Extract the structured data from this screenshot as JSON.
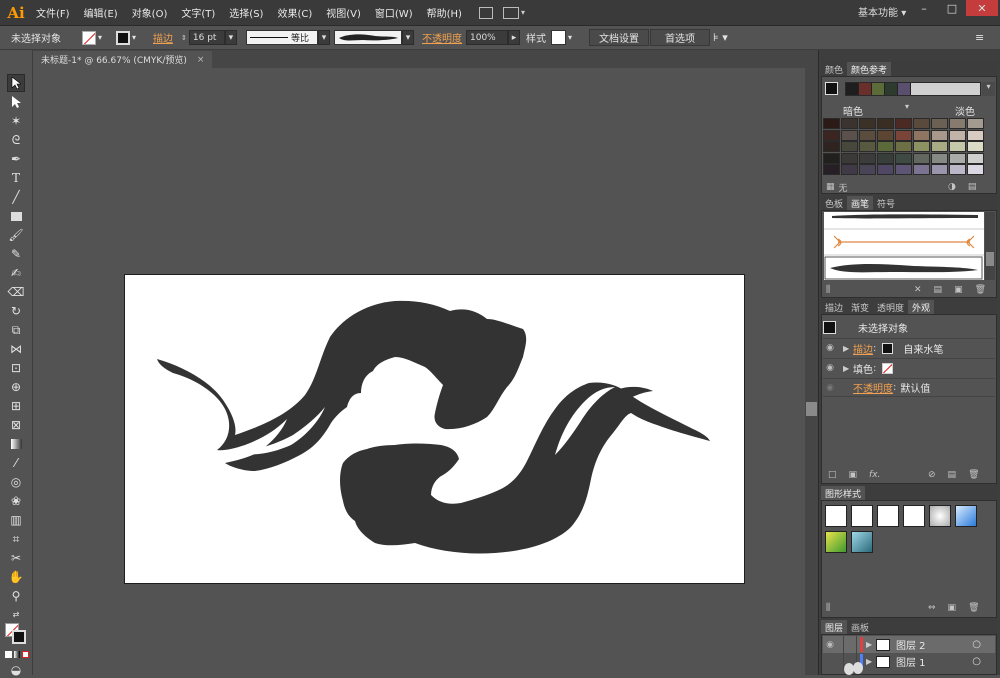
{
  "app": {
    "logo": "Ai",
    "menus": [
      "文件(F)",
      "编辑(E)",
      "对象(O)",
      "文字(T)",
      "选择(S)",
      "效果(C)",
      "视图(V)",
      "窗口(W)",
      "帮助(H)"
    ],
    "workspace": "基本功能",
    "window_controls": [
      "–",
      "□",
      "✕"
    ]
  },
  "control_bar": {
    "selection_label": "未选择对象",
    "stroke_label": "描边",
    "stroke_value": "16 pt",
    "stroke_profile": "等比",
    "opacity_label": "不透明度",
    "opacity_value": "100%",
    "style_label": "样式",
    "doc_setup_button": "文档设置",
    "preferences_button": "首选项"
  },
  "document_tab": {
    "title": "未标题-1* @ 66.67% (CMYK/预览)",
    "close": "×"
  },
  "color_panel": {
    "tabs": [
      "颜色",
      "颜色参考"
    ],
    "dark_label": "暗色",
    "light_label": "淡色",
    "none_label": "无",
    "harmony_colors": [
      "#1e1e1e",
      "#6b2f2b",
      "#5c6b3a",
      "#2c3b2e",
      "#5a4f6e"
    ],
    "grid_colors": [
      [
        "#2b1a16",
        "#3a3330",
        "#3b3127",
        "#3a2d22",
        "#4a2a22",
        "#5a4a3c",
        "#6b6054",
        "#877b70",
        "#a39b90"
      ],
      [
        "#3a2520",
        "#5a514c",
        "#5a4d3d",
        "#5d4533",
        "#7a4438",
        "#8f7462",
        "#a8978a",
        "#c2b3a8",
        "#d8ccc2"
      ],
      [
        "#2f2320",
        "#48473c",
        "#575a3e",
        "#5b6a38",
        "#6d6f45",
        "#8e9161",
        "#a9ab84",
        "#c6c7a8",
        "#dcdcc6"
      ],
      [
        "#22201e",
        "#3b3a38",
        "#3c3c3c",
        "#383f3a",
        "#3f4a44",
        "#62675f",
        "#868a84",
        "#aaaca9",
        "#cfcfcd"
      ],
      [
        "#262026",
        "#3f3a46",
        "#4a4457",
        "#4f4763",
        "#5e5574",
        "#7b7390",
        "#9b95ac",
        "#bcb7c8",
        "#dcd8e3"
      ]
    ]
  },
  "brushes_panel": {
    "tabs": [
      "色板",
      "画笔",
      "符号"
    ]
  },
  "appearance_panel": {
    "tabs": [
      "描边",
      "渐变",
      "透明度",
      "外观"
    ],
    "header": "未选择对象",
    "stroke_label": "描边",
    "stroke_brush": "自来水笔",
    "fill_label": "填色",
    "opacity_label": "不透明度",
    "opacity_value": "默认值",
    "footer_fx": "fx."
  },
  "graphic_styles_panel": {
    "tabs": [
      "图形样式"
    ]
  },
  "layers_panel": {
    "tabs": [
      "图层",
      "画板"
    ],
    "layers": [
      {
        "name": "图层 2",
        "color": "#e04040"
      },
      {
        "name": "图层 1",
        "color": "#4f7fff"
      }
    ]
  }
}
